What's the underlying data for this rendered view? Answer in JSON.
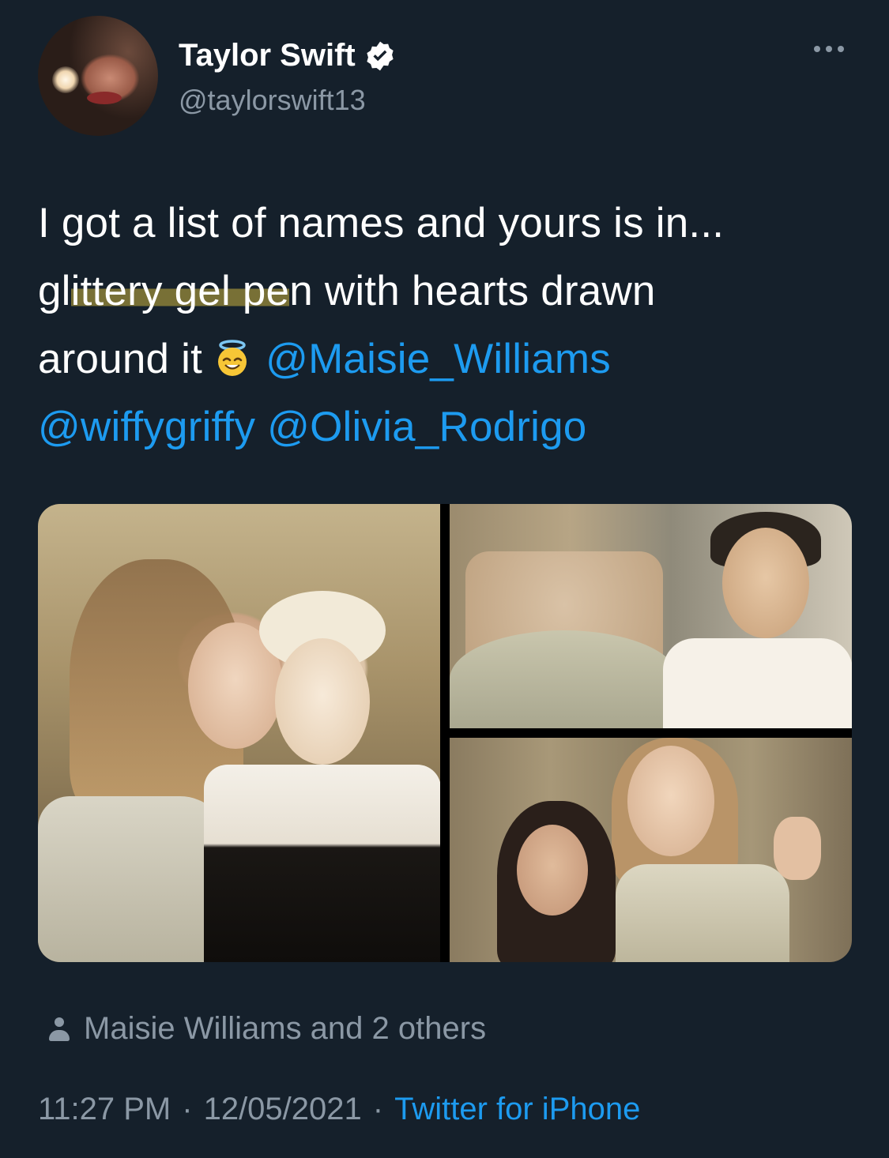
{
  "user": {
    "display_name": "Taylor Swift",
    "handle": "@taylorswift13",
    "verified": true,
    "avatar_alt": ""
  },
  "tweet": {
    "line1": "I got a list of names and yours is in...",
    "line2_pre": "gl",
    "line2_highlight": "ittery gel pe",
    "line2_post": "n with hearts drawn",
    "line3": "around it",
    "emoji": "smiling-face-with-halo",
    "mentions": [
      "@Maisie_Williams",
      "@wiffygriffy",
      "@Olivia_Rodrigo"
    ]
  },
  "media": {
    "photo_count": 3
  },
  "likers": {
    "text": "Maisie Williams and 2 others"
  },
  "meta": {
    "time": "11:27 PM",
    "sep1": "·",
    "date": "12/05/2021",
    "sep2": "·",
    "source": "Twitter for iPhone"
  },
  "colors": {
    "background": "#15202b",
    "text_primary": "#ffffff",
    "text_secondary": "#8b98a5",
    "accent_link": "#1d9bf0",
    "highlight": "#c9b13f"
  }
}
